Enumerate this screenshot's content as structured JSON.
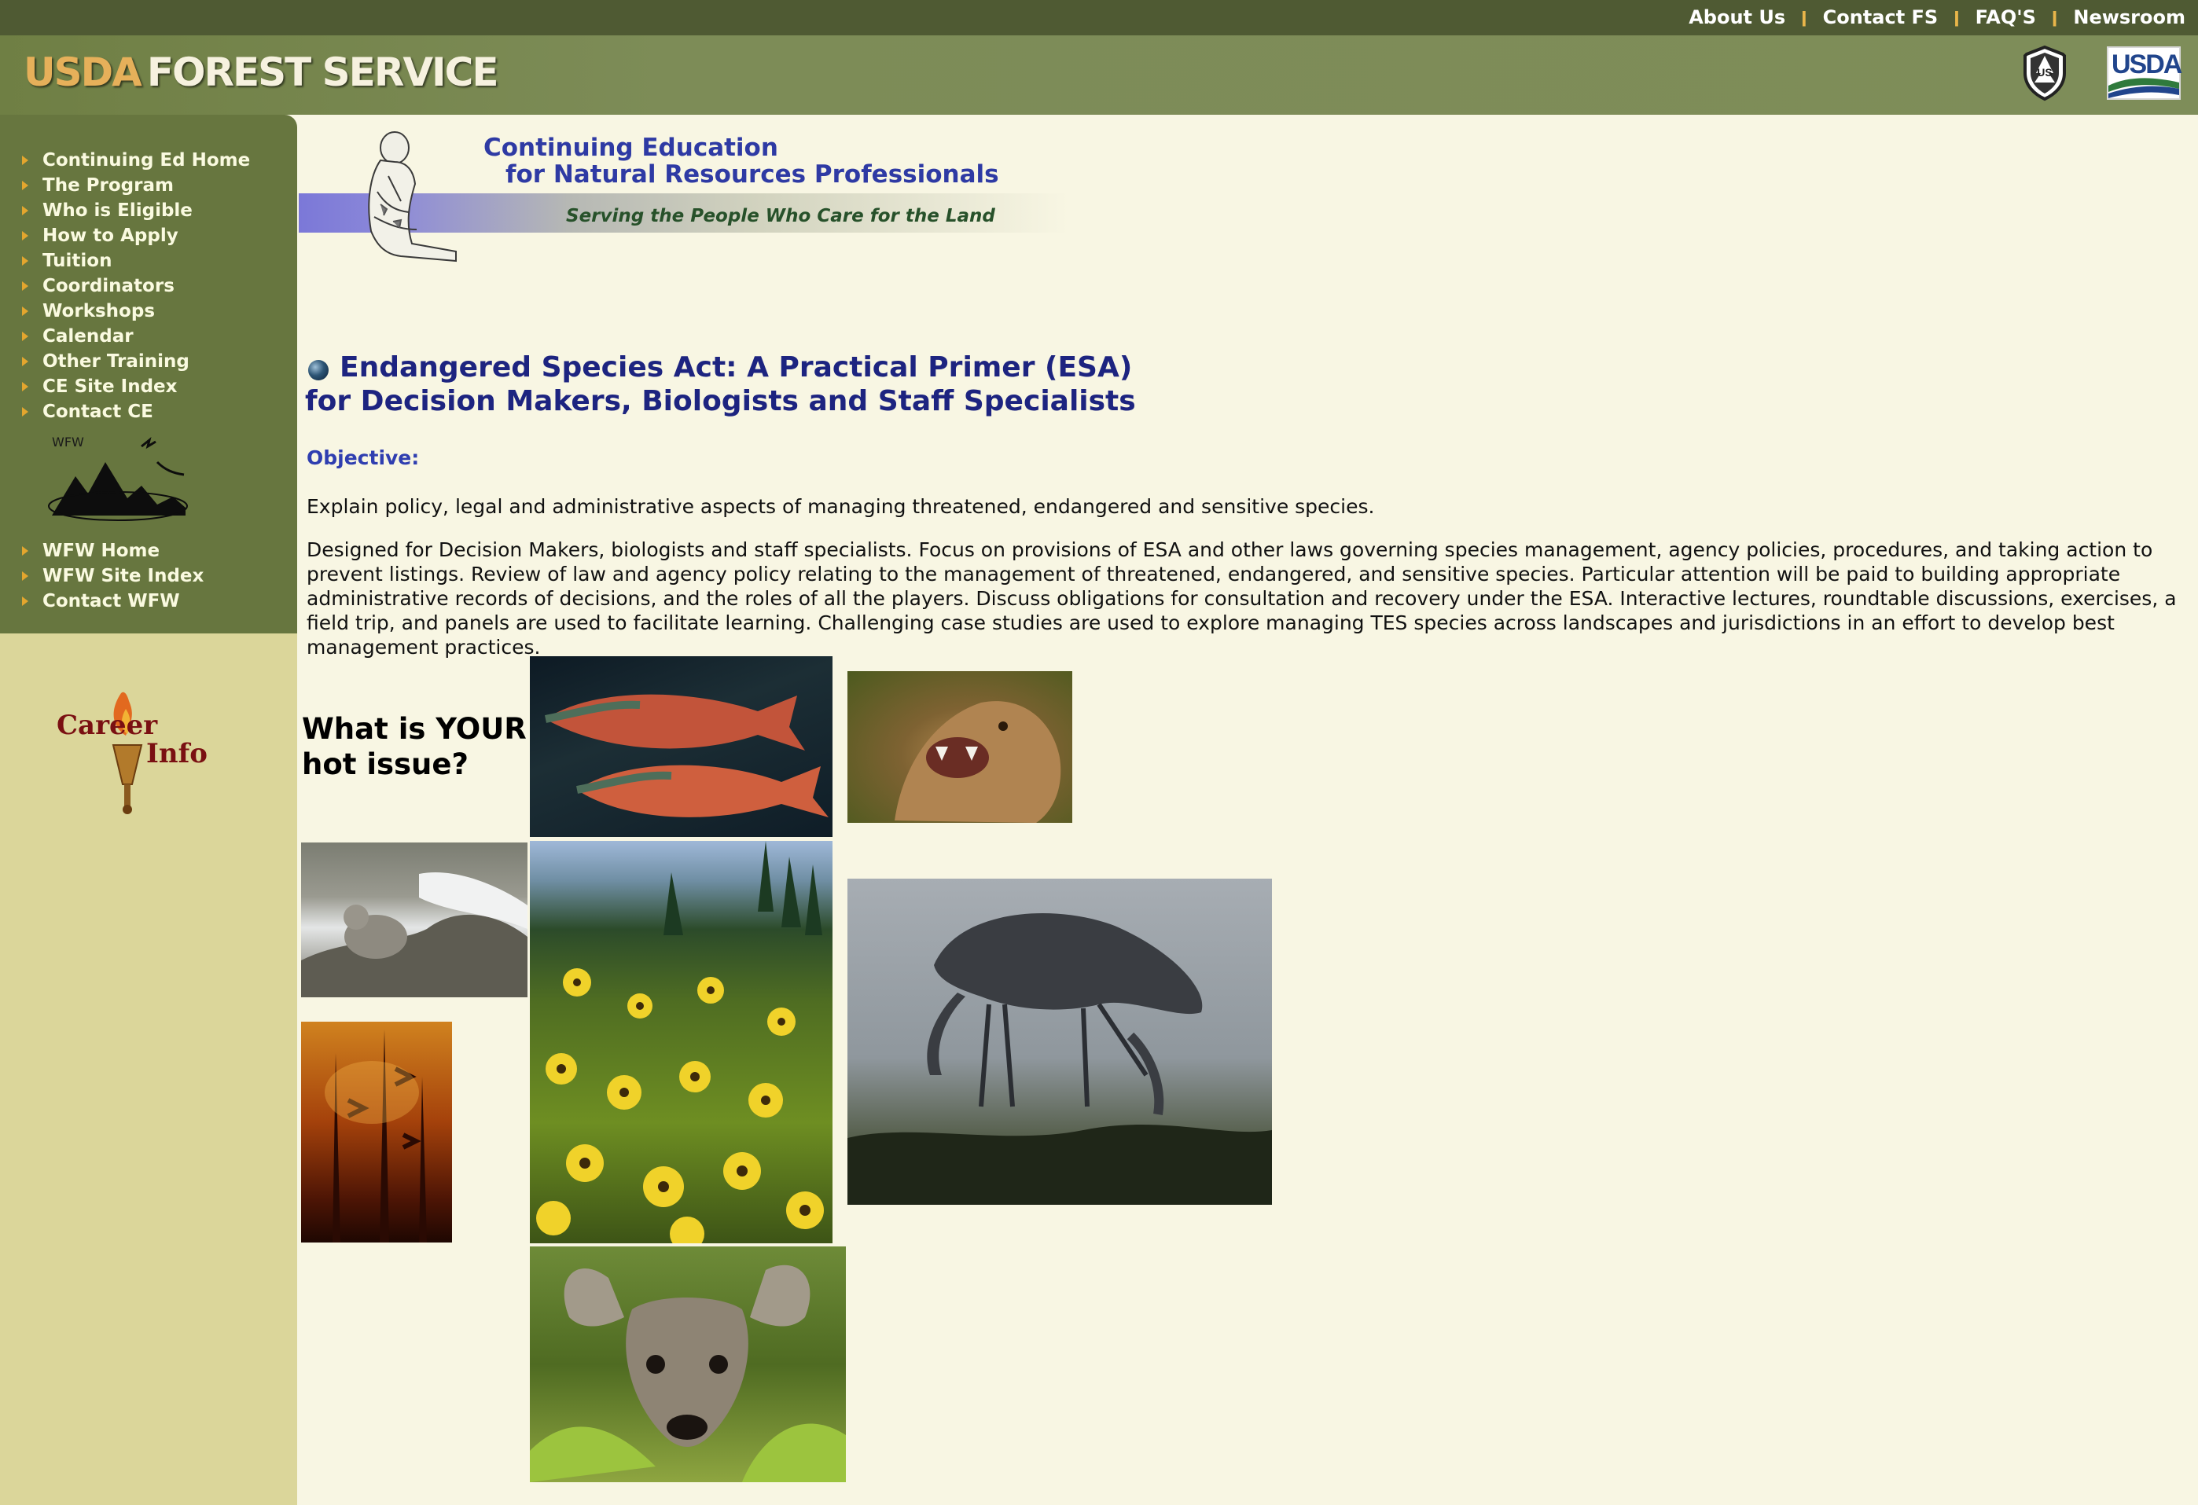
{
  "top_nav": {
    "links": [
      "About Us",
      "Contact FS",
      "FAQ'S",
      "Newsroom"
    ]
  },
  "header": {
    "logo_usda": "USDA",
    "logo_forest_service": "FOREST SERVICE",
    "shield_text": "US",
    "usda_badge_text": "USDA"
  },
  "sidebar": {
    "ce_links": [
      "Continuing Ed Home",
      "The Program",
      "Who is Eligible",
      "How to Apply",
      "Tuition",
      "Coordinators",
      "Workshops",
      "Calendar",
      "Other Training",
      "CE Site Index",
      "Contact CE"
    ],
    "wfw_logo_text": "WFW",
    "wfw_links": [
      "WFW Home",
      "WFW Site Index",
      "Contact WFW"
    ],
    "career_line1": "Career",
    "career_line2": "Info"
  },
  "banner": {
    "title_line1": "Continuing Education",
    "title_line2": "for Natural Resources Professionals",
    "tagline": "Serving the People Who Care for the Land"
  },
  "main": {
    "title_line1": "Endangered Species Act: A Practical Primer (ESA)",
    "title_line2": "for Decision Makers, Biologists and Staff Specialists",
    "objective_label": "Objective:",
    "objective_text": "Explain policy, legal and administrative aspects of managing threatened, endangered and sensitive species.",
    "description": "Designed for Decision Makers, biologists and staff specialists. Focus on provisions of ESA and other laws governing species management, agency policies, procedures, and taking action to prevent listings. Review of law and agency policy relating to the management of threatened, endangered, and sensitive species. Particular attention will be paid to building appropriate administrative records of decisions, and the roles of all the players. Discuss obligations for consultation and recovery under the ESA. Interactive lectures, roundtable discussions, exercises, a field trip, and panels are used to facilitate learning. Challenging case studies are used to explore managing TES species across landscapes and jurisdictions in an effort to develop best management practices.",
    "hot_issue_line1": "What is YOUR",
    "hot_issue_line2": "hot issue?"
  },
  "colors": {
    "top_bar": "#4f5a33",
    "header_band": "#7d8c57",
    "sidebar_nav": "#67763f",
    "sidebar_lower": "#dbd69a",
    "page_background": "#f8f6e3",
    "title_blue": "#1d2480",
    "nav_arrow": "#e3a62e"
  }
}
